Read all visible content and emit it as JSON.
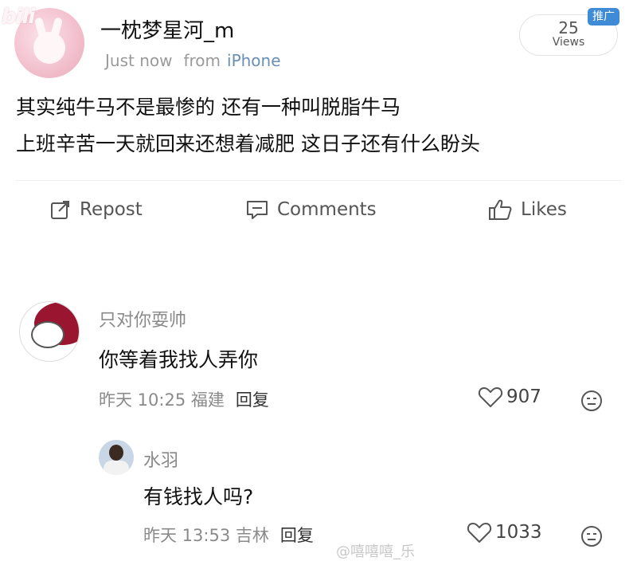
{
  "watermark_top": "bili",
  "header": {
    "username": "一枕梦星河_m",
    "time": "Just now",
    "from_label": "from",
    "device": "iPhone",
    "views_count": "25",
    "views_label": "Views",
    "promo_badge": "推广"
  },
  "post": {
    "line1": "其实纯牛马不是最惨的 还有一种叫脱脂牛马",
    "line2": "上班辛苦一天就回来还想着减肥 这日子还有什么盼头"
  },
  "actions": {
    "repost": "Repost",
    "comments": "Comments",
    "likes": "Likes"
  },
  "comments": [
    {
      "name": "只对你耍帅",
      "text": "你等着我找人弄你",
      "meta": "昨天 10:25 福建",
      "reply": "回复",
      "likes": "907"
    },
    {
      "name": "水羽",
      "text": "有钱找人吗?",
      "meta": "昨天 13:53 吉林",
      "reply": "回复",
      "likes": "1033"
    }
  ],
  "watermark_bottom": "@嘻嘻嘻_乐",
  "colors": {
    "link_blue": "#6a8fb6",
    "badge_blue": "#3f8bd6",
    "muted_gray": "#8a8a8a"
  }
}
